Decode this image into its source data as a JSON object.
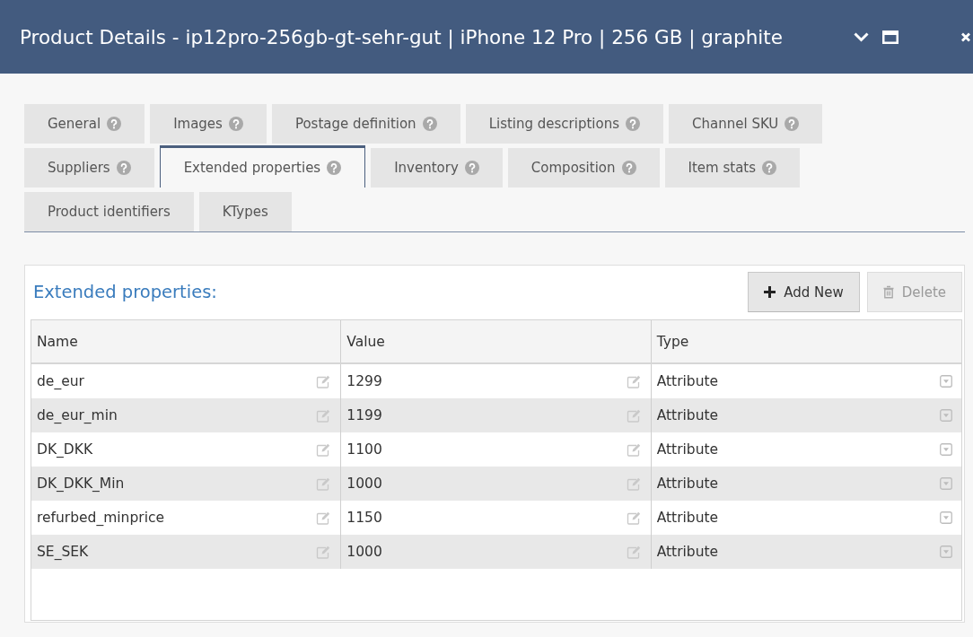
{
  "window": {
    "title": "Product Details - ip12pro-256gb-gt-sehr-gut | iPhone 12 Pro | 256 GB | graphite"
  },
  "tab_rows": [
    {
      "tabs": [
        {
          "label": "General",
          "help": true,
          "selected": false
        },
        {
          "label": "Images",
          "help": true,
          "selected": false
        },
        {
          "label": "Postage definition",
          "help": true,
          "selected": false
        },
        {
          "label": "Listing descriptions",
          "help": true,
          "selected": false
        },
        {
          "label": "Channel SKU",
          "help": true,
          "selected": false
        }
      ]
    },
    {
      "tabs": [
        {
          "label": "Suppliers",
          "help": true,
          "selected": false
        },
        {
          "label": "Extended properties",
          "help": true,
          "selected": true
        },
        {
          "label": "Inventory",
          "help": true,
          "selected": false
        },
        {
          "label": "Composition",
          "help": true,
          "selected": false
        },
        {
          "label": "Item stats",
          "help": true,
          "selected": false
        }
      ]
    },
    {
      "tabs": [
        {
          "label": "Product identifiers",
          "help": false,
          "selected": false
        },
        {
          "label": "KTypes",
          "help": false,
          "selected": false
        }
      ]
    }
  ],
  "panel": {
    "title": "Extended properties:",
    "buttons": [
      {
        "label": "Add New",
        "kind": "add",
        "disabled": false
      },
      {
        "label": "Delete",
        "kind": "delete",
        "disabled": true
      }
    ],
    "table": {
      "columns": [
        "Name",
        "Value",
        "Type"
      ],
      "rows": [
        {
          "name": "de_eur",
          "value": "1299",
          "type": "Attribute"
        },
        {
          "name": "de_eur_min",
          "value": "1199",
          "type": "Attribute"
        },
        {
          "name": "DK_DKK",
          "value": "1100",
          "type": "Attribute"
        },
        {
          "name": "DK_DKK_Min",
          "value": "1000",
          "type": "Attribute"
        },
        {
          "name": "refurbed_minprice",
          "value": "1150",
          "type": "Attribute"
        },
        {
          "name": "SE_SEK",
          "value": "1000",
          "type": "Attribute"
        }
      ]
    }
  }
}
